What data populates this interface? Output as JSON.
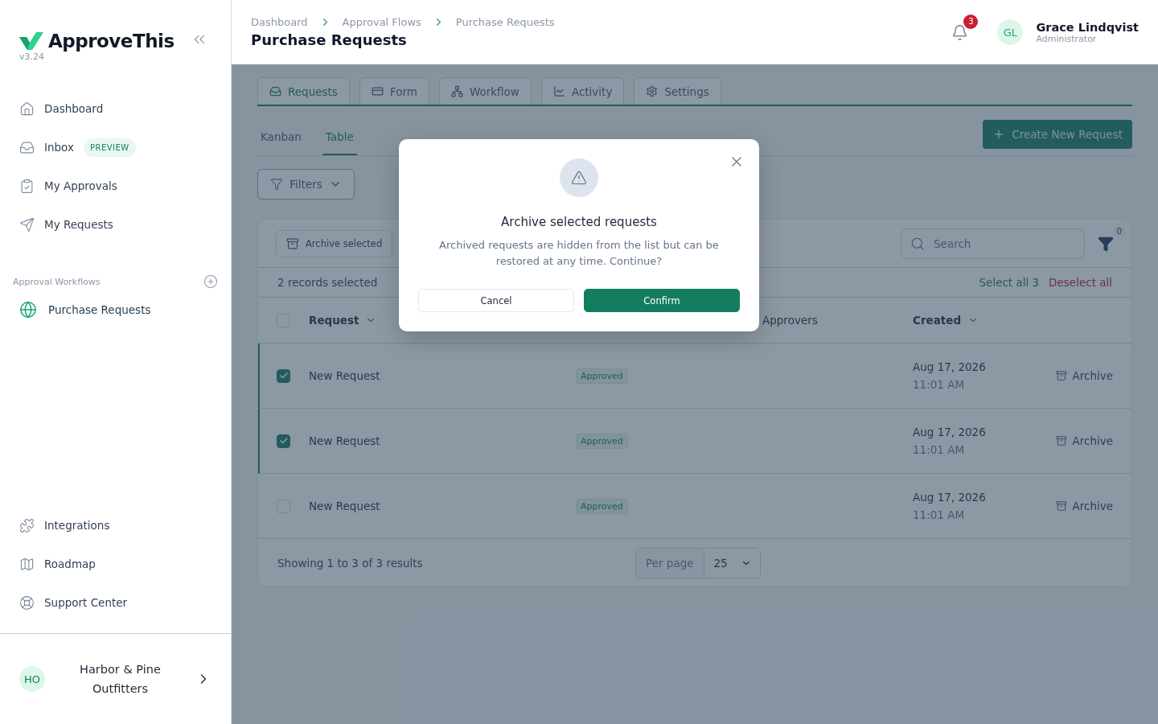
{
  "sidebar": {
    "brand": "ApproveThis",
    "version": "v3.24",
    "nav": [
      {
        "label": "Dashboard"
      },
      {
        "label": "Inbox",
        "badge": "PREVIEW"
      },
      {
        "label": "My Approvals"
      },
      {
        "label": "My Requests"
      }
    ],
    "section_title": "Approval Workflows",
    "workflows": [
      {
        "label": "Purchase Requests",
        "selected": true
      }
    ],
    "bottom_nav": [
      {
        "label": "Integrations"
      },
      {
        "label": "Roadmap"
      },
      {
        "label": "Support Center"
      }
    ],
    "org": {
      "initials": "HO",
      "name": "Harbor & Pine Outfitters"
    }
  },
  "header": {
    "breadcrumbs": [
      "Dashboard",
      "Approval Flows",
      "Purchase Requests"
    ],
    "title": "Purchase Requests",
    "notifications": "3",
    "user": {
      "initials": "GL",
      "name": "Grace Lindqvist",
      "role": "Administrator"
    }
  },
  "tabs": [
    {
      "label": "Requests",
      "selected": true
    },
    {
      "label": "Form",
      "selected": false
    },
    {
      "label": "Workflow",
      "selected": false
    },
    {
      "label": "Activity",
      "selected": false
    },
    {
      "label": "Settings",
      "selected": false
    }
  ],
  "views": [
    {
      "label": "Kanban",
      "selected": false
    },
    {
      "label": "Table",
      "selected": true
    }
  ],
  "create_button": "Create New Request",
  "filters_button": "Filters",
  "table": {
    "archive_selected": "Archive selected",
    "search_placeholder": "Search",
    "filter_count": "0",
    "selection_text": "2 records selected",
    "select_all": "Select all 3",
    "deselect_all": "Deselect all",
    "all_checked": false,
    "headers": {
      "request": "Request",
      "approvers": "Approvers",
      "created": "Created"
    },
    "rows": [
      {
        "request": "New Request",
        "status": "Approved",
        "date": "Aug 17, 2026",
        "time": "11:01 AM",
        "action": "Archive",
        "selected": true
      },
      {
        "request": "New Request",
        "status": "Approved",
        "date": "Aug 17, 2026",
        "time": "11:01 AM",
        "action": "Archive",
        "selected": true
      },
      {
        "request": "New Request",
        "status": "Approved",
        "date": "Aug 17, 2026",
        "time": "11:01 AM",
        "action": "Archive",
        "selected": false
      }
    ],
    "footer": "Showing 1 to 3 of 3 results",
    "per_page_label": "Per page",
    "per_page": "25"
  },
  "modal": {
    "title": "Archive selected requests",
    "message": "Archived requests are hidden from the list but can be restored at any time. Continue?",
    "cancel": "Cancel",
    "confirm": "Confirm"
  }
}
